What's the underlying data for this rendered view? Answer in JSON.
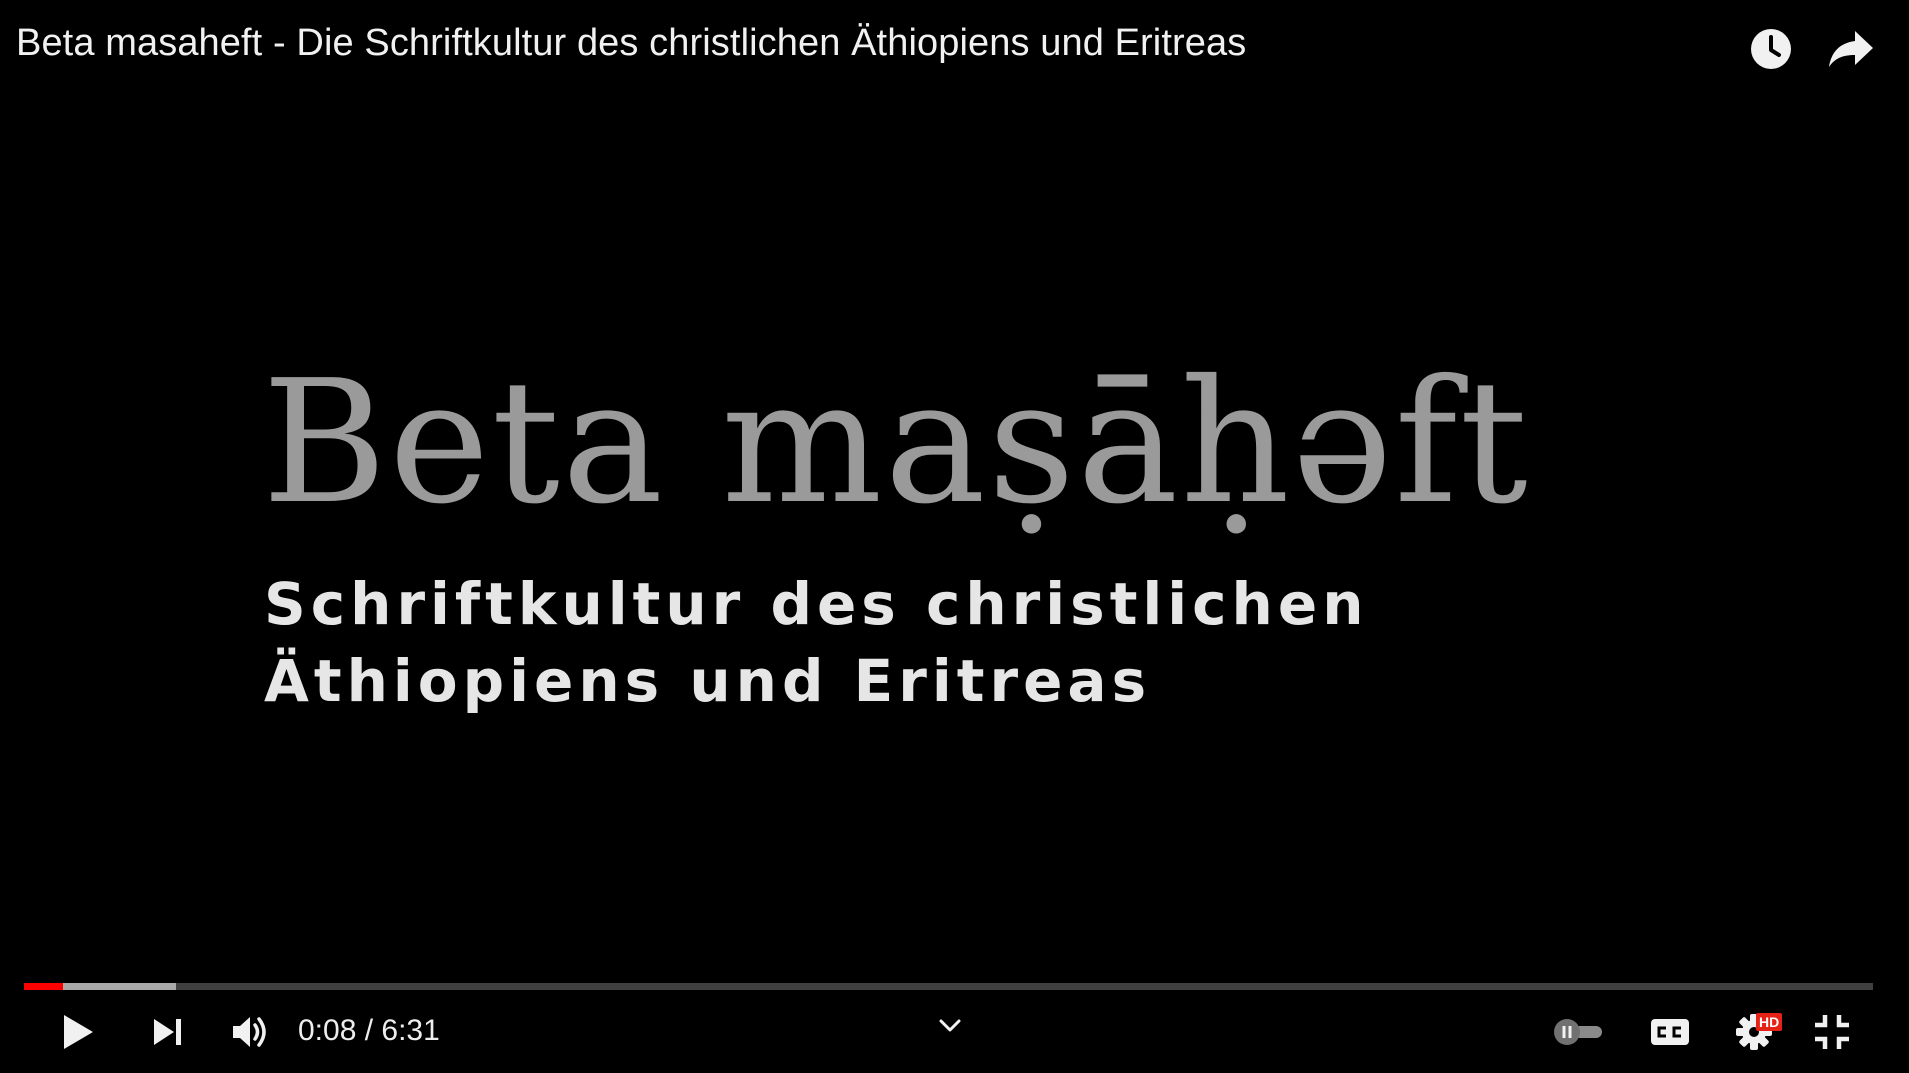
{
  "player": {
    "title": "Beta masaheft - Die Schriftkultur des christlichen Äthiopiens und Eritreas",
    "top_icons": [
      "clock-icon",
      "share-arrow-icon"
    ]
  },
  "frame": {
    "logo_title": "Beta maṣāḥəft",
    "subtitle_line1": "Schriftkultur des christlichen",
    "subtitle_line2": "Äthiopiens und Eritreas"
  },
  "controls": {
    "current_time": "0:08",
    "duration": "6:31",
    "time_display": "0:08 / 6:31",
    "played_fraction": 0.021,
    "buffered_fraction": 0.082,
    "hd_badge": "HD",
    "accent_color": "#ff0000",
    "hd_color": "#e62117",
    "icons": [
      "play-icon",
      "next-icon",
      "volume-icon",
      "chevron-down-icon",
      "autoplay-toggle-icon",
      "cc-icon",
      "settings-gear-icon",
      "exit-fullscreen-icon"
    ]
  }
}
